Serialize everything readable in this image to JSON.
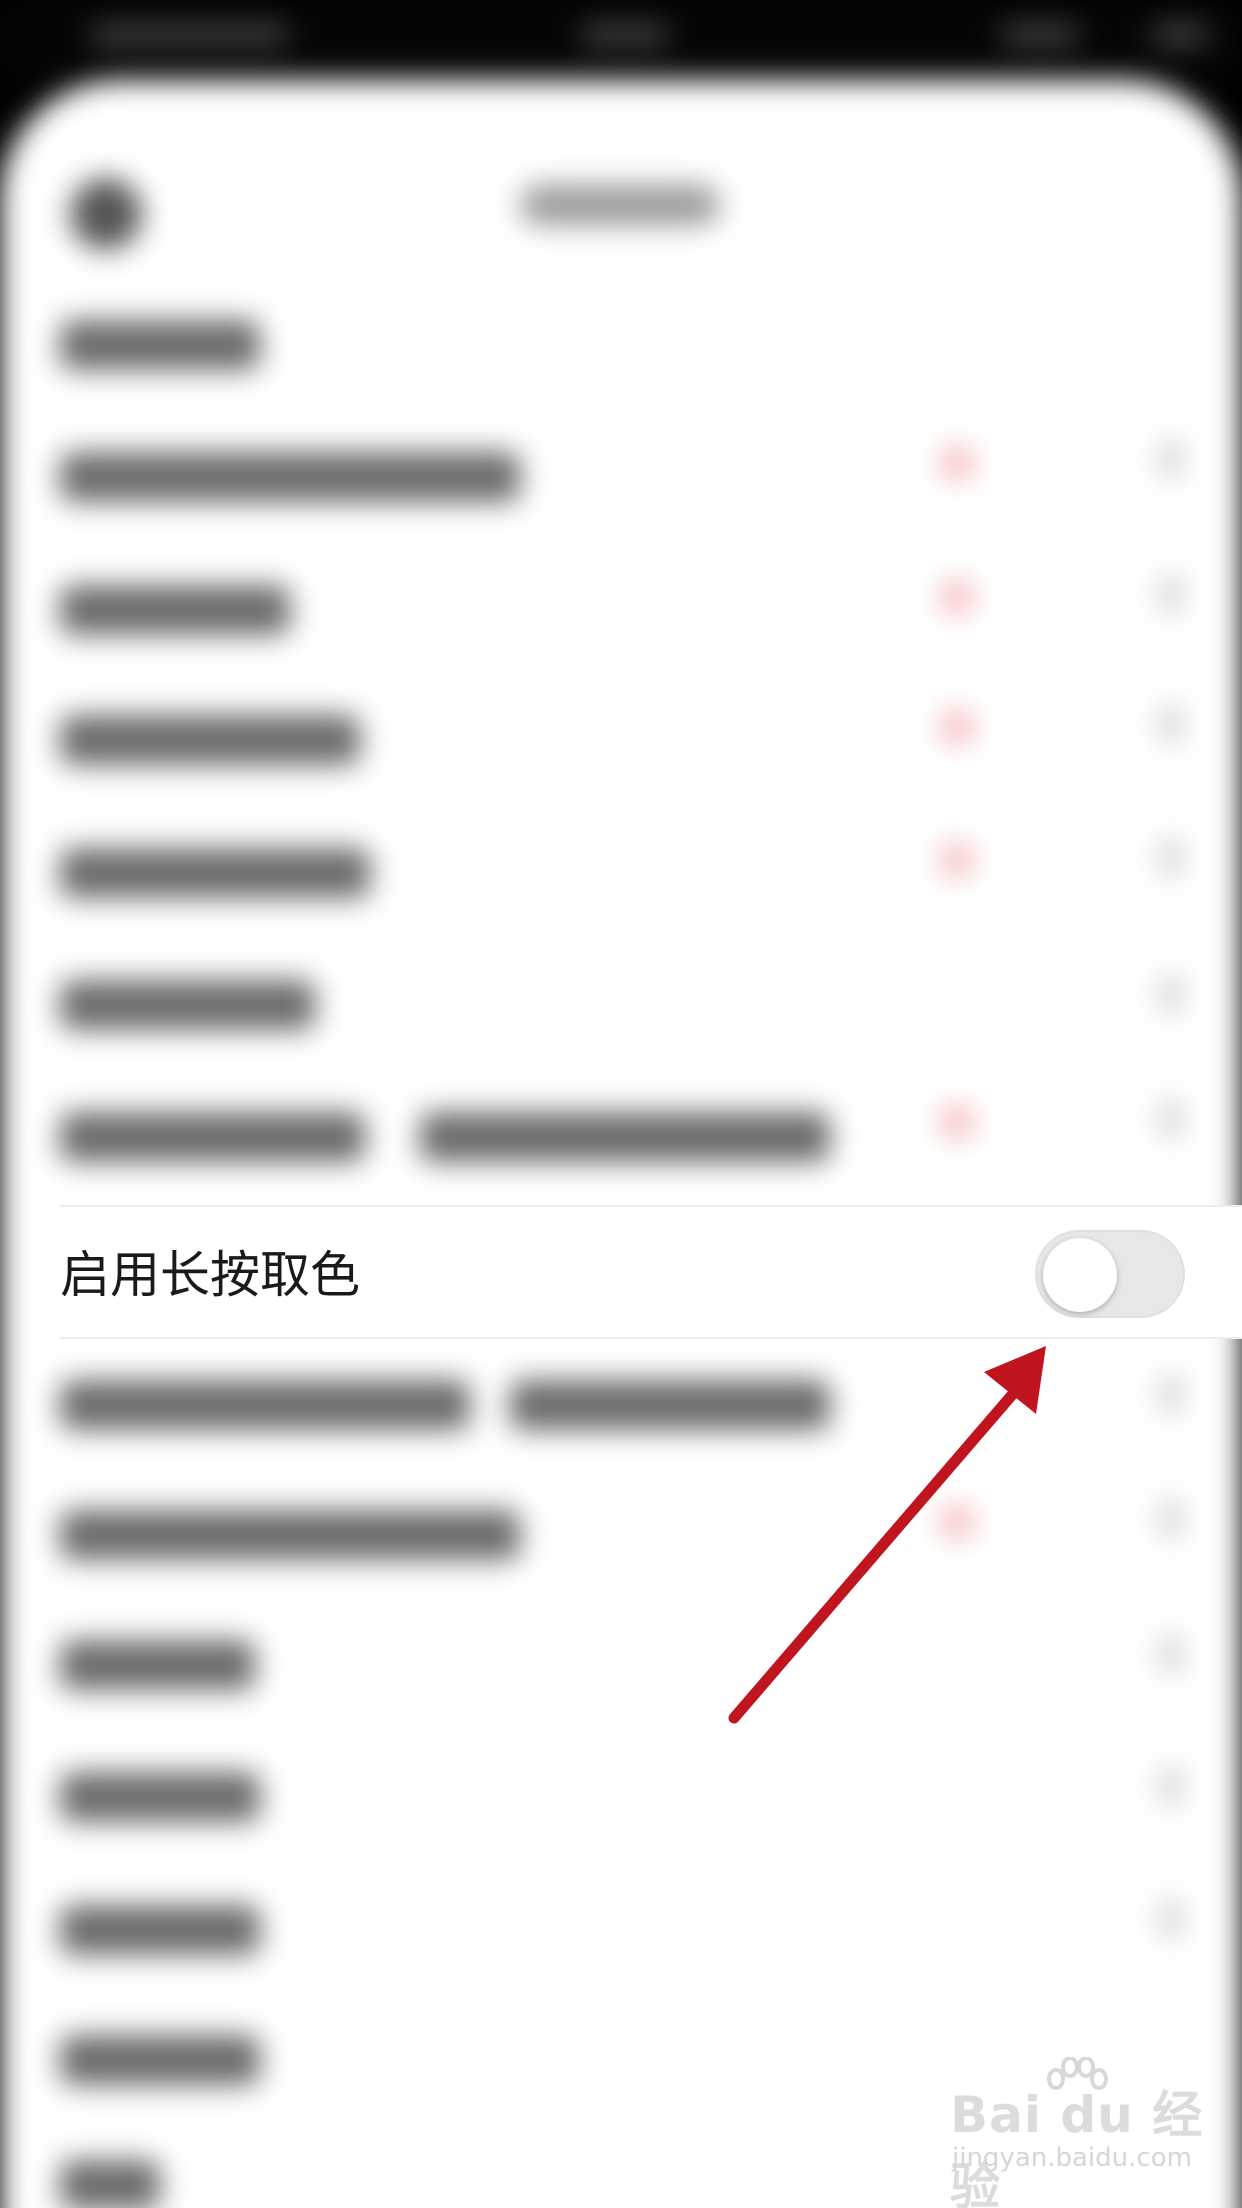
{
  "setting_row": {
    "label": "启用长按取色",
    "toggle_on": false
  },
  "watermark": {
    "brand": "Bai du 经验",
    "url": "jingyan.baidu.com"
  },
  "colors": {
    "annotation_arrow": "#c0141e",
    "toggle_track": "#e7e7e7",
    "text": "#1a1a1a"
  }
}
